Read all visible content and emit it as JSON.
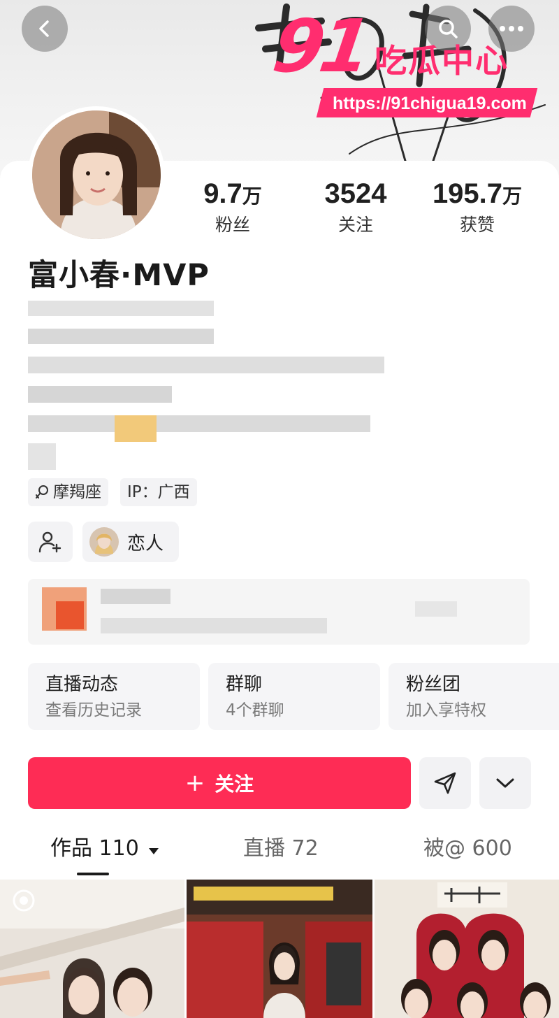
{
  "watermark": {
    "brand_number": "91",
    "brand_text": "吃瓜中心",
    "url": "https://91chigua19.com"
  },
  "header": {
    "back_icon": "chevron-left-icon",
    "search_icon": "search-icon",
    "more_icon": "more-horizontal-icon"
  },
  "profile": {
    "name": "富小春·MVP",
    "stats": [
      {
        "value": "9.7",
        "unit": "万",
        "label": "粉丝"
      },
      {
        "value": "3524",
        "unit": "",
        "label": "关注"
      },
      {
        "value": "195.7",
        "unit": "万",
        "label": "获赞"
      }
    ],
    "tags": [
      {
        "icon": "female-symbol-icon",
        "label": "摩羯座"
      },
      {
        "label": "IP：广西"
      }
    ],
    "lover_label": "恋人"
  },
  "features": [
    {
      "title": "直播动态",
      "subtitle": "查看历史记录"
    },
    {
      "title": "群聊",
      "subtitle": "4个群聊"
    },
    {
      "title": "粉丝团",
      "subtitle": "加入享特权"
    }
  ],
  "actions": {
    "follow_label": "关注",
    "follow_prefix": "+"
  },
  "tabs": [
    {
      "label": "作品 110"
    },
    {
      "label": "直播 72"
    },
    {
      "label": "被@ 600"
    }
  ],
  "colors": {
    "accent": "#fe2c55",
    "watermark": "#ff2d6f",
    "chip_bg": "#f3f3f5"
  }
}
